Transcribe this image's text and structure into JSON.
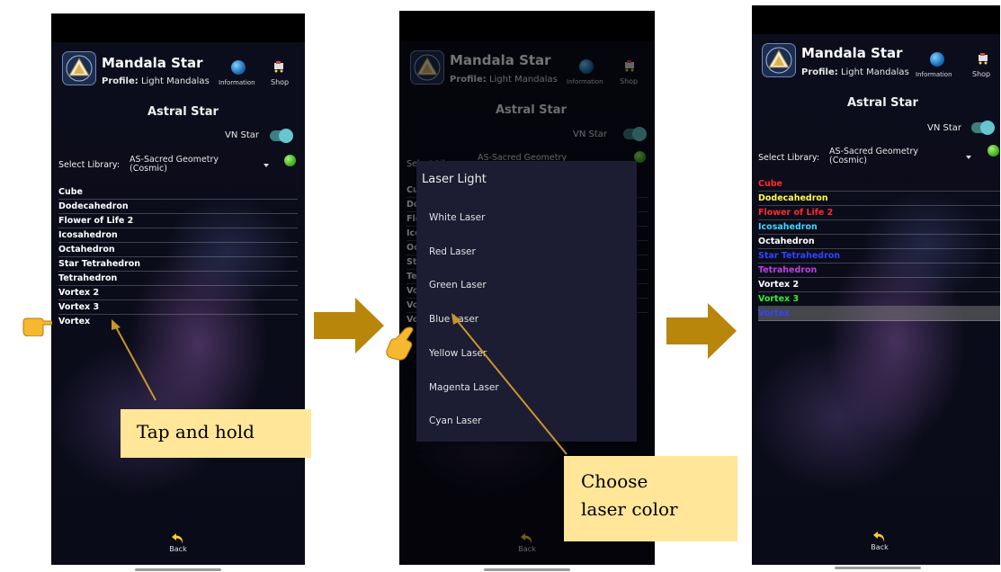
{
  "app": {
    "title": "Mandala Star",
    "profile_prefix": "Profile:",
    "profile_name": "Light Mandalas",
    "information_label": "Information",
    "shop_label": "Shop",
    "section_title": "Astral Star",
    "vn_star_label": "VN Star",
    "library_label": "Select Library:",
    "library_value": "AS-Sacred Geometry (Cosmic)",
    "back_label": "Back"
  },
  "list": [
    {
      "label": "Cube",
      "color": "#ff2a2a"
    },
    {
      "label": "Dodecahedron",
      "color": "#ffff44"
    },
    {
      "label": "Flower of Life 2",
      "color": "#ff2a2a"
    },
    {
      "label": "Icosahedron",
      "color": "#3fd8ff"
    },
    {
      "label": "Octahedron",
      "color": "#ffffff"
    },
    {
      "label": "Star Tetrahedron",
      "color": "#3344ff"
    },
    {
      "label": "Tetrahedron",
      "color": "#c040e0"
    },
    {
      "label": "Vortex 2",
      "color": "#ffffff"
    },
    {
      "label": "Vortex 3",
      "color": "#33ee33"
    },
    {
      "label": "Vortex",
      "color": "#3344ff"
    }
  ],
  "dialog": {
    "title": "Laser Light",
    "options": [
      "White Laser",
      "Red Laser",
      "Green Laser",
      "Blue Laser",
      "Yellow Laser",
      "Magenta Laser",
      "Cyan Laser"
    ]
  },
  "callouts": {
    "tap_and_hold": "Tap and hold",
    "choose_line1": "Choose",
    "choose_line2": "laser color"
  },
  "colors": {
    "step_arrow": "#b8860b",
    "pointer_line": "#c8962a",
    "callout_bg": "#ffe699",
    "toggle_on": "#67c6cf",
    "library_indicator": "#4fc22a"
  },
  "icons": {
    "logo": "sacred-geometry-pyramid-logo",
    "information": "globe-icon",
    "shop": "shopping-cart-icon",
    "back": "curved-back-arrow-icon",
    "pointer": "pointing-hand-icon",
    "step": "right-arrow-icon"
  }
}
